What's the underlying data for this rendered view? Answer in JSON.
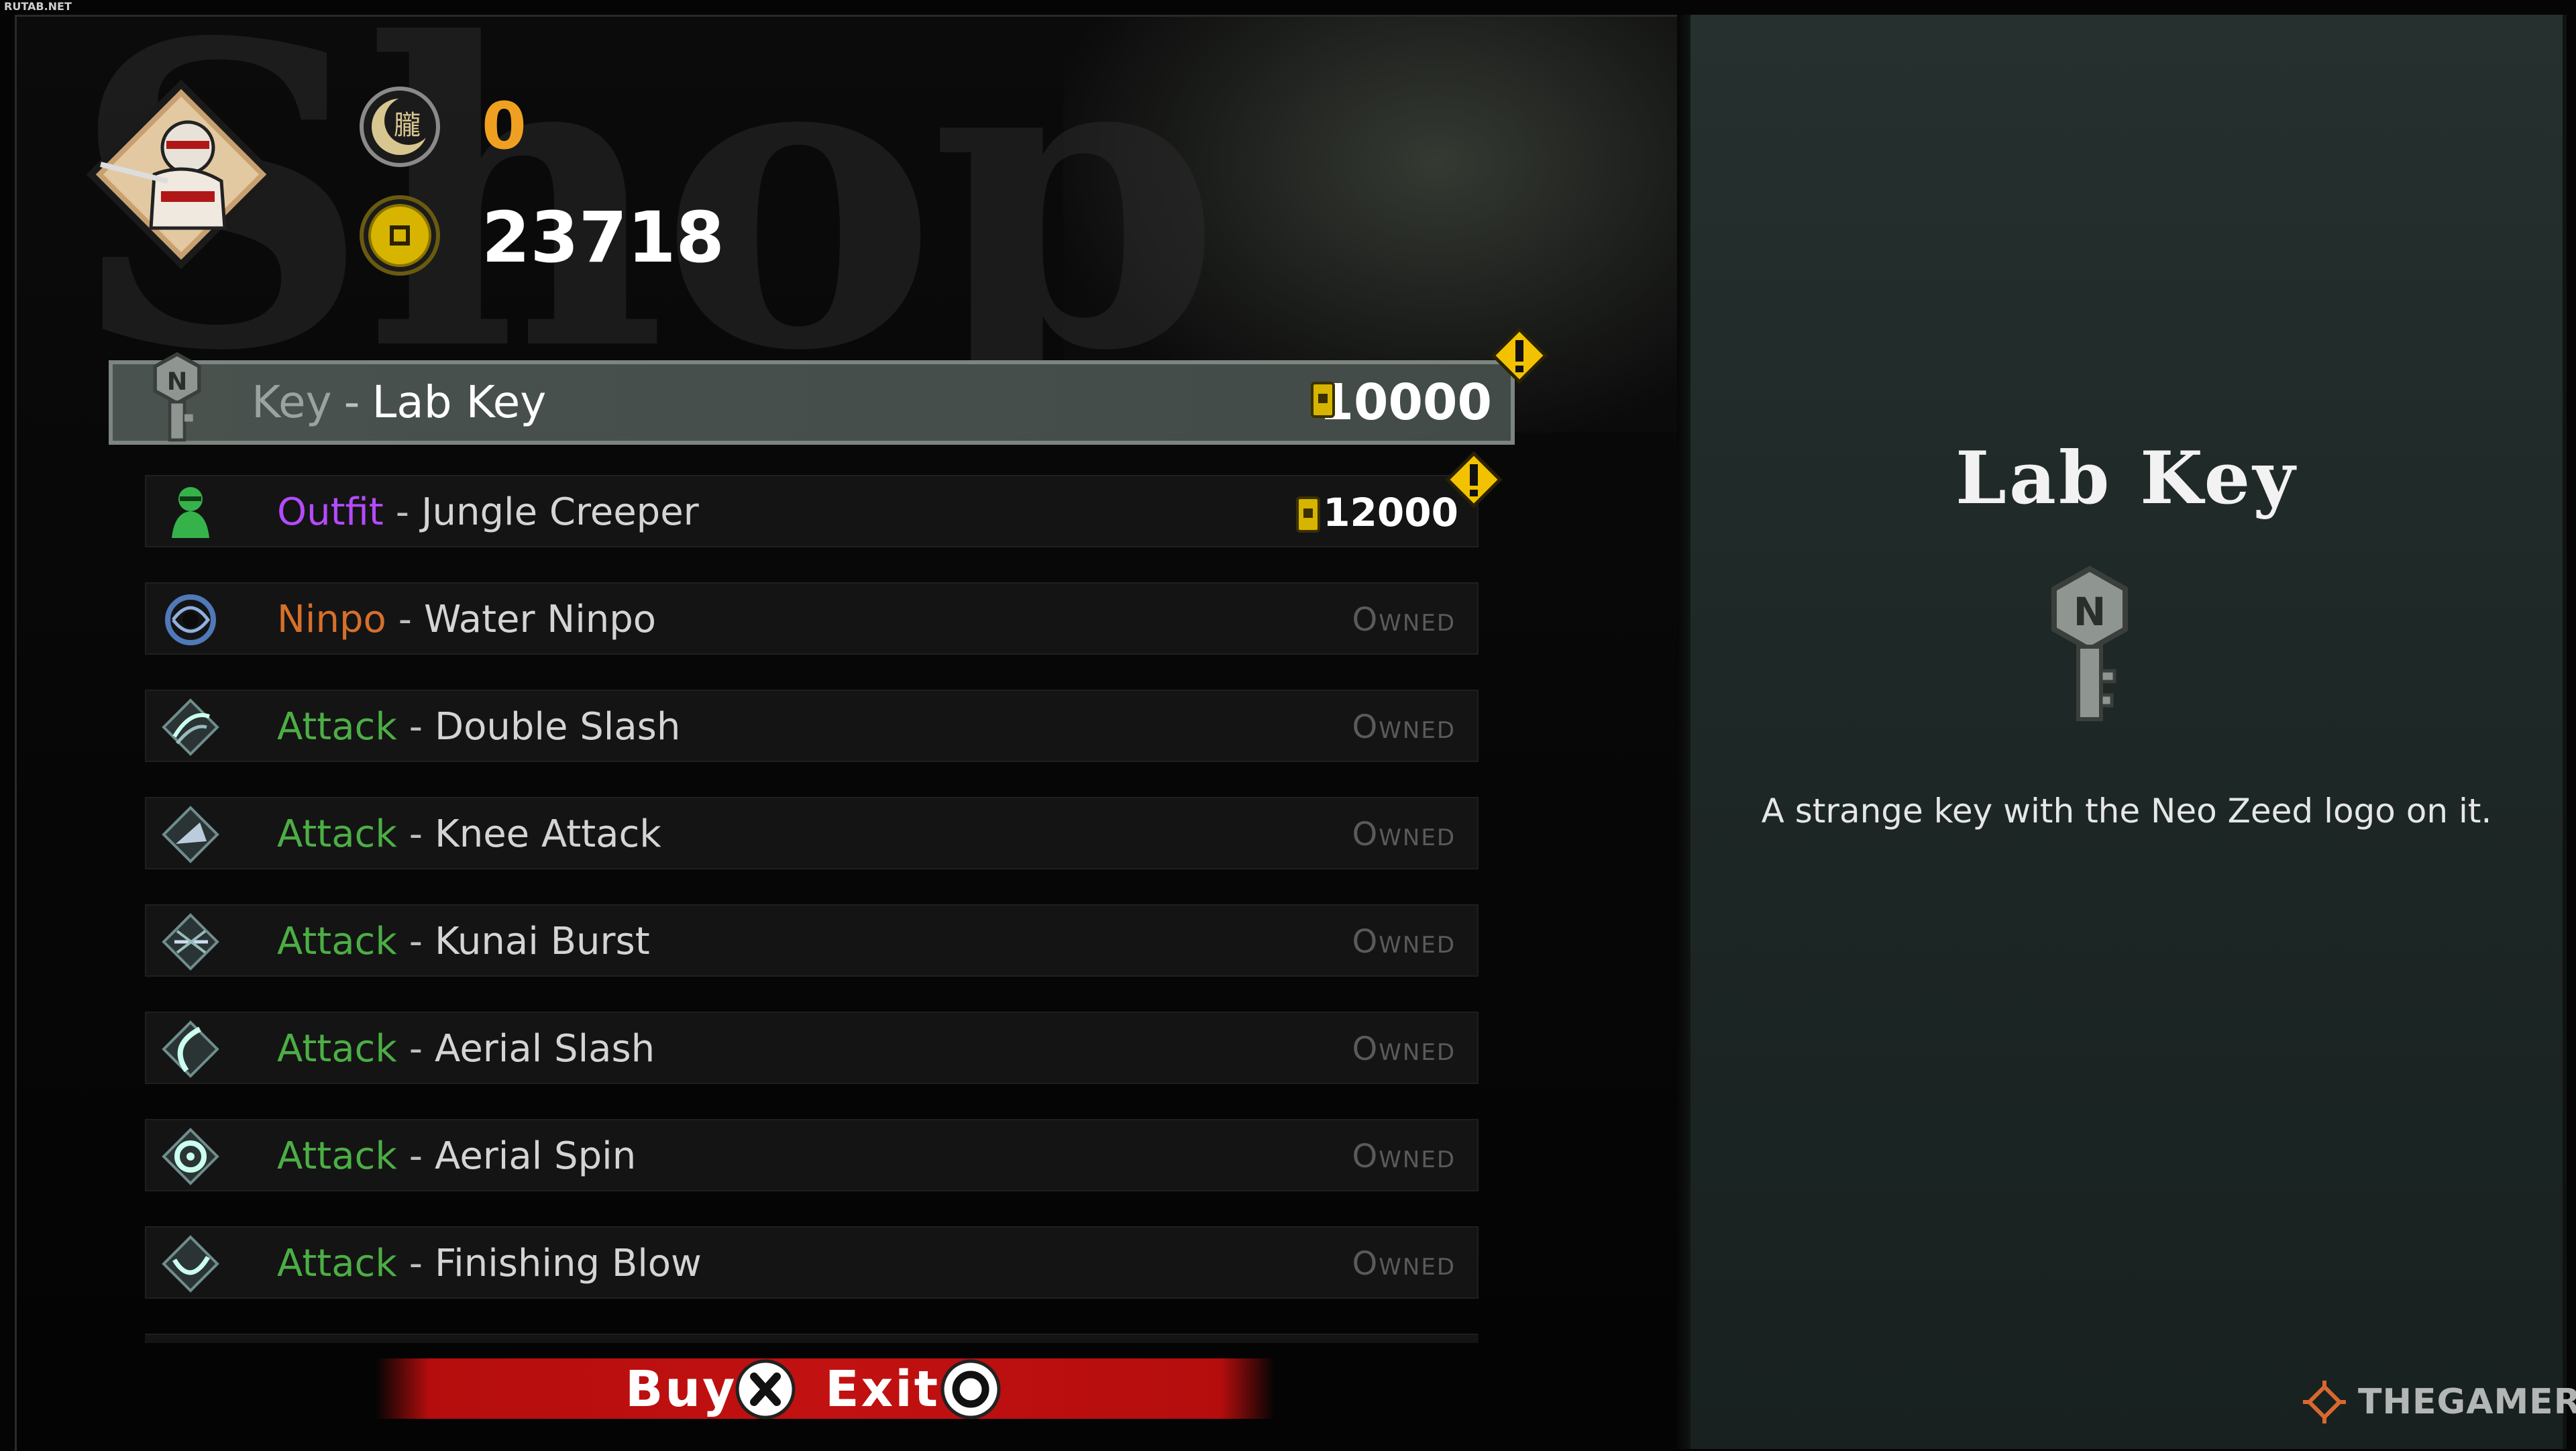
{
  "corner_tag": "RUTAB.NET",
  "header": {
    "watermark_title": "Shop",
    "spirit_currency": {
      "icon": "moon-kanji-coin-icon",
      "value": "0",
      "color": "#f0a020"
    },
    "gold_currency": {
      "icon": "gold-coin-icon",
      "value": "23718",
      "color": "#ffffff"
    }
  },
  "category_colors": {
    "Key": "#9aa3a0",
    "Outfit": "#b34bff",
    "Ninpo": "#d6702a",
    "Attack": "#4cae45"
  },
  "items": [
    {
      "type": "Key",
      "name": "Lab Key",
      "price": "10000",
      "status": "price",
      "icon": "key-icon",
      "selected": true,
      "new": true
    },
    {
      "type": "Outfit",
      "name": "Jungle Creeper",
      "price": "12000",
      "status": "price",
      "icon": "ninja-outfit-icon",
      "selected": false,
      "new": true
    },
    {
      "type": "Ninpo",
      "name": "Water Ninpo",
      "status": "Owned",
      "icon": "water-swirl-icon"
    },
    {
      "type": "Attack",
      "name": "Double Slash",
      "status": "Owned",
      "icon": "double-slash-icon"
    },
    {
      "type": "Attack",
      "name": "Knee Attack",
      "status": "Owned",
      "icon": "knee-attack-icon"
    },
    {
      "type": "Attack",
      "name": "Kunai Burst",
      "status": "Owned",
      "icon": "kunai-burst-icon"
    },
    {
      "type": "Attack",
      "name": "Aerial Slash",
      "status": "Owned",
      "icon": "aerial-slash-icon"
    },
    {
      "type": "Attack",
      "name": "Aerial Spin",
      "status": "Owned",
      "icon": "aerial-spin-icon"
    },
    {
      "type": "Attack",
      "name": "Finishing Blow",
      "status": "Owned",
      "icon": "finishing-blow-icon"
    }
  ],
  "separator": "-",
  "detail": {
    "title": "Lab Key",
    "icon": "key-icon",
    "description": "A strange key with the Neo Zeed logo on it."
  },
  "actions": {
    "buy_label": "Buy",
    "buy_button": "cross-button-icon",
    "exit_label": "Exit",
    "exit_button": "circle-button-icon"
  },
  "brand": "THEGAMER"
}
